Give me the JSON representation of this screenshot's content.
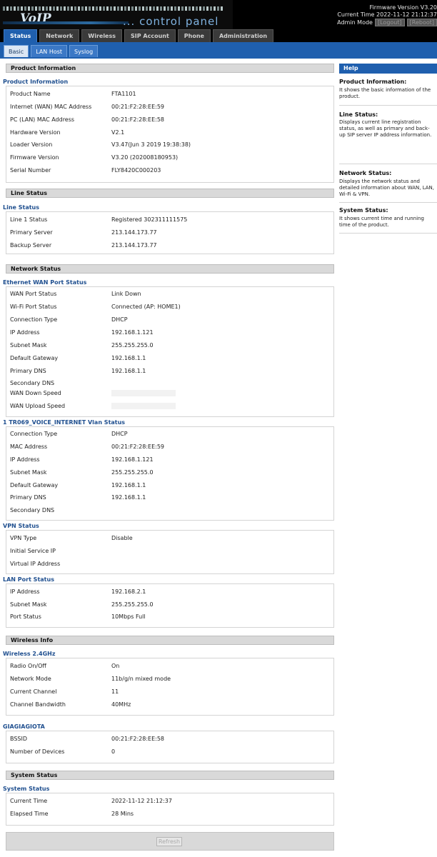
{
  "header": {
    "logo_main": "VoIP",
    "logo_sub": "... control panel",
    "firmware_line": "Firmware Version V3.20",
    "time_line": "Current Time 2022-11-12 21:12:37",
    "admin_mode": "Admin Mode",
    "logout": "[Logout]",
    "reboot": "[Reboot]"
  },
  "main_tabs": [
    "Status",
    "Network",
    "Wireless",
    "SIP Account",
    "Phone",
    "Administration"
  ],
  "sub_tabs": [
    "Basic",
    "LAN Host",
    "Syslog"
  ],
  "product": {
    "section": "Product Information",
    "group": "Product Information",
    "rows": [
      {
        "label": "Product Name",
        "value": "FTA1101"
      },
      {
        "label": "Internet (WAN) MAC Address",
        "value": "00:21:F2:28:EE:59"
      },
      {
        "label": "PC (LAN) MAC Address",
        "value": "00:21:F2:28:EE:58"
      },
      {
        "label": "Hardware Version",
        "value": "V2.1"
      },
      {
        "label": "Loader Version",
        "value": "V3.47(Jun 3 2019 19:38:38)"
      },
      {
        "label": "Firmware Version",
        "value": "V3.20 (202008180953)"
      },
      {
        "label": "Serial Number",
        "value": "FLY8420C000203"
      }
    ]
  },
  "line": {
    "section": "Line Status",
    "group": "Line Status",
    "rows": [
      {
        "label": "Line 1 Status",
        "value": "Registered 302311111575"
      },
      {
        "label": "Primary Server",
        "value": "213.144.173.77"
      },
      {
        "label": "Backup Server",
        "value": "213.144.173.77"
      }
    ]
  },
  "network": {
    "section": "Network Status",
    "wan_group": "Ethernet WAN Port Status",
    "wan_rows": [
      {
        "label": "WAN Port Status",
        "value": "Link Down"
      },
      {
        "label": "Wi-Fi Port Status",
        "value": "Connected (AP: HOME1)"
      },
      {
        "label": "Connection Type",
        "value": "DHCP"
      },
      {
        "label": "IP Address",
        "value": "192.168.1.121"
      },
      {
        "label": "Subnet Mask",
        "value": "255.255.255.0"
      },
      {
        "label": "Default Gateway",
        "value": "192.168.1.1"
      },
      {
        "label": "Primary DNS",
        "value": "192.168.1.1"
      },
      {
        "label": "Secondary DNS",
        "value": ""
      },
      {
        "label": "WAN Down Speed",
        "value": ""
      },
      {
        "label": "WAN Upload Speed",
        "value": ""
      }
    ],
    "vlan_group": "1 TR069_VOICE_INTERNET Vlan Status",
    "vlan_rows": [
      {
        "label": "Connection Type",
        "value": "DHCP"
      },
      {
        "label": "MAC Address",
        "value": "00:21:F2:28:EE:59"
      },
      {
        "label": "IP Address",
        "value": "192.168.1.121"
      },
      {
        "label": "Subnet Mask",
        "value": "255.255.255.0"
      },
      {
        "label": "Default Gateway",
        "value": "192.168.1.1"
      },
      {
        "label": "Primary DNS",
        "value": "192.168.1.1"
      },
      {
        "label": "Secondary DNS",
        "value": ""
      }
    ],
    "vpn_group": "VPN Status",
    "vpn_rows": [
      {
        "label": "VPN Type",
        "value": "Disable"
      },
      {
        "label": "Initial Service IP",
        "value": ""
      },
      {
        "label": "Virtual IP Address",
        "value": ""
      }
    ],
    "lan_group": "LAN Port Status",
    "lan_rows": [
      {
        "label": "IP Address",
        "value": "192.168.2.1"
      },
      {
        "label": "Subnet Mask",
        "value": "255.255.255.0"
      },
      {
        "label": "Port Status",
        "value": "10Mbps Full"
      }
    ]
  },
  "wireless": {
    "section": "Wireless Info",
    "group": "Wireless 2.4GHz",
    "rows": [
      {
        "label": "Radio On/Off",
        "value": "On"
      },
      {
        "label": "Network Mode",
        "value": "11b/g/n mixed mode"
      },
      {
        "label": "Current Channel",
        "value": "11"
      },
      {
        "label": "Channel Bandwidth",
        "value": "40MHz"
      }
    ],
    "ssid_group": "GIAGIAGIOTA",
    "ssid_rows": [
      {
        "label": "BSSID",
        "value": "00:21:F2:28:EE:58"
      },
      {
        "label": "Number of Devices",
        "value": "0"
      }
    ]
  },
  "system": {
    "section": "System Status",
    "group": "System Status",
    "rows": [
      {
        "label": "Current Time",
        "value": "2022-11-12 21:12:37"
      },
      {
        "label": "Elapsed Time",
        "value": "28 Mins"
      }
    ]
  },
  "refresh_label": "Refresh",
  "help": {
    "title": "Help",
    "items": [
      {
        "title": "Product Information:",
        "text": "It shows the basic information of the product."
      },
      {
        "title": "Line Status:",
        "text": "Displays current line registration status, as well as primary and back-up SIP server IP address information."
      },
      {
        "title": "Network Status:",
        "text": "Displays the network status and detailed information about WAN, LAN, Wi-Fi & VPN."
      },
      {
        "title": "System Status:",
        "text": "It shows current time and running time of the product."
      }
    ]
  },
  "colors": {
    "tab_active": "#1f5fae",
    "group_title": "#1f4f8f",
    "section_bar": "#d9d9d9"
  }
}
